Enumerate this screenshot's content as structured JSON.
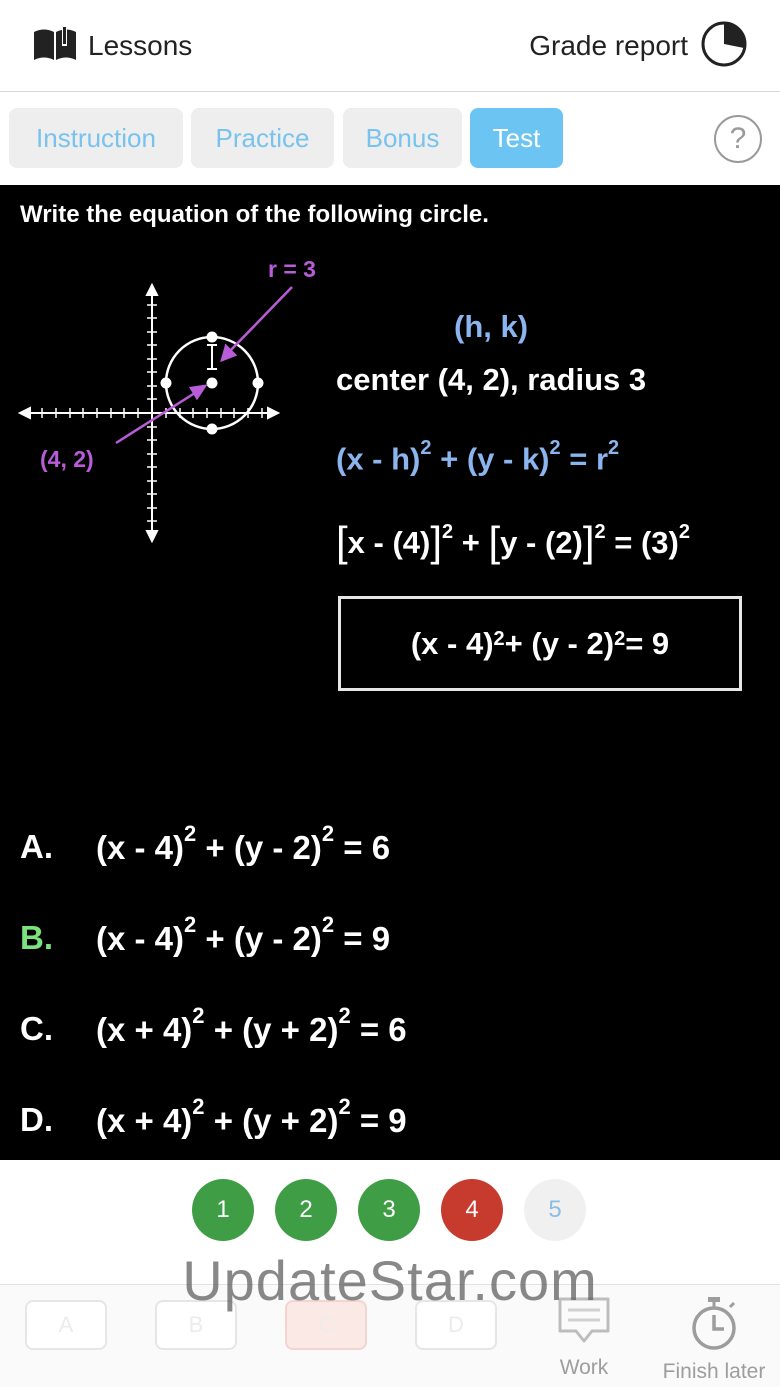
{
  "header": {
    "lessons_label": "Lessons",
    "grade_report_label": "Grade report"
  },
  "tabs": [
    {
      "label": "Instruction",
      "active": false
    },
    {
      "label": "Practice",
      "active": false
    },
    {
      "label": "Bonus",
      "active": false
    },
    {
      "label": "Test",
      "active": true
    }
  ],
  "help_label": "?",
  "problem": {
    "question": "Write the equation of the following circle.",
    "graph_labels": {
      "radius": "r = 3",
      "center_point": "(4, 2)"
    },
    "hk_label": "(h, k)",
    "center_text": "center (4, 2), radius 3",
    "general_form": {
      "a": "(x - h)",
      "b": " + (y - k)",
      "c": " = r",
      "exp": "2"
    },
    "substituted": {
      "lb1": "[",
      "a": "x - (4)",
      "rb1": "]",
      "plus": " + ",
      "lb2": "[",
      "b": "y - (2)",
      "rb2": "]",
      "eq": " = (3)",
      "exp": "2"
    },
    "result": {
      "a": "(x - 4)",
      "b": " + (y - 2)",
      "c": " = 9",
      "exp": "2"
    }
  },
  "choices": [
    {
      "letter": "A.",
      "a": "(x - 4)",
      "b": " + (y - 2)",
      "c": " = 6",
      "exp": "2",
      "correct": false
    },
    {
      "letter": "B.",
      "a": "(x - 4)",
      "b": " + (y - 2)",
      "c": " = 9",
      "exp": "2",
      "correct": true
    },
    {
      "letter": "C.",
      "a": "(x + 4)",
      "b": " + (y + 2)",
      "c": " = 6",
      "exp": "2",
      "correct": false
    },
    {
      "letter": "D.",
      "a": "(x + 4)",
      "b": " + (y + 2)",
      "c": " = 9",
      "exp": "2",
      "correct": false
    }
  ],
  "progress": [
    {
      "label": "1",
      "status": "correct",
      "color": "#3f9e45"
    },
    {
      "label": "2",
      "status": "correct",
      "color": "#3f9e45"
    },
    {
      "label": "3",
      "status": "correct",
      "color": "#3f9e45"
    },
    {
      "label": "4",
      "status": "incorrect",
      "color": "#c73a2e"
    },
    {
      "label": "5",
      "status": "pending",
      "color": "#f0f0f0"
    }
  ],
  "toolbar": {
    "answers": [
      "A",
      "B",
      "C",
      "D"
    ],
    "work_label": "Work",
    "finish_later_label": "Finish later"
  },
  "watermark": "UpdateStar.com",
  "colors": {
    "accent": "#6cc4f2",
    "math_blue": "#8ab5ee",
    "graph_purple": "#b85cd8",
    "correct_green": "#7ce37c"
  }
}
